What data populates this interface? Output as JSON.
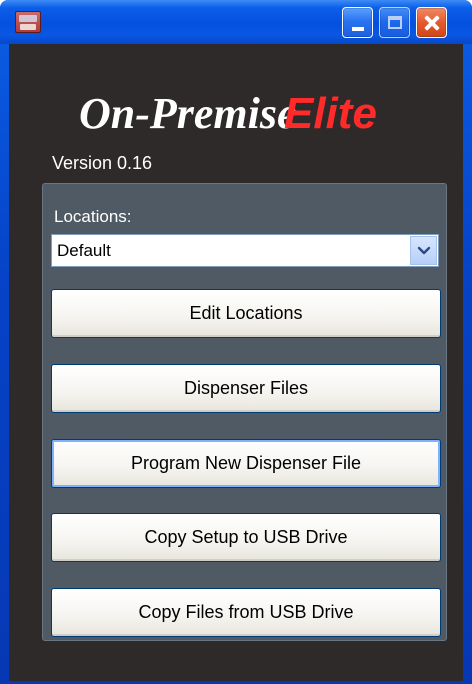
{
  "window": {
    "title": "",
    "controls": {
      "minimize_icon": "minimize-icon",
      "maximize_icon": "maximize-icon",
      "close_icon": "close-icon"
    }
  },
  "brand": {
    "logo_part1": "On-Premise",
    "logo_part2": "Elite",
    "colors": {
      "logo_part1": "#ffffff",
      "logo_part2": "#ff2a2a"
    }
  },
  "version_text": "Version 0.16",
  "locations": {
    "label": "Locations:",
    "selected": "Default"
  },
  "actions": {
    "edit_locations": "Edit Locations",
    "dispenser_files": "Dispenser Files",
    "program_new_dispenser_file": "Program New Dispenser File",
    "copy_setup_to_usb": "Copy Setup to USB Drive",
    "copy_files_from_usb": "Copy Files from USB Drive"
  }
}
